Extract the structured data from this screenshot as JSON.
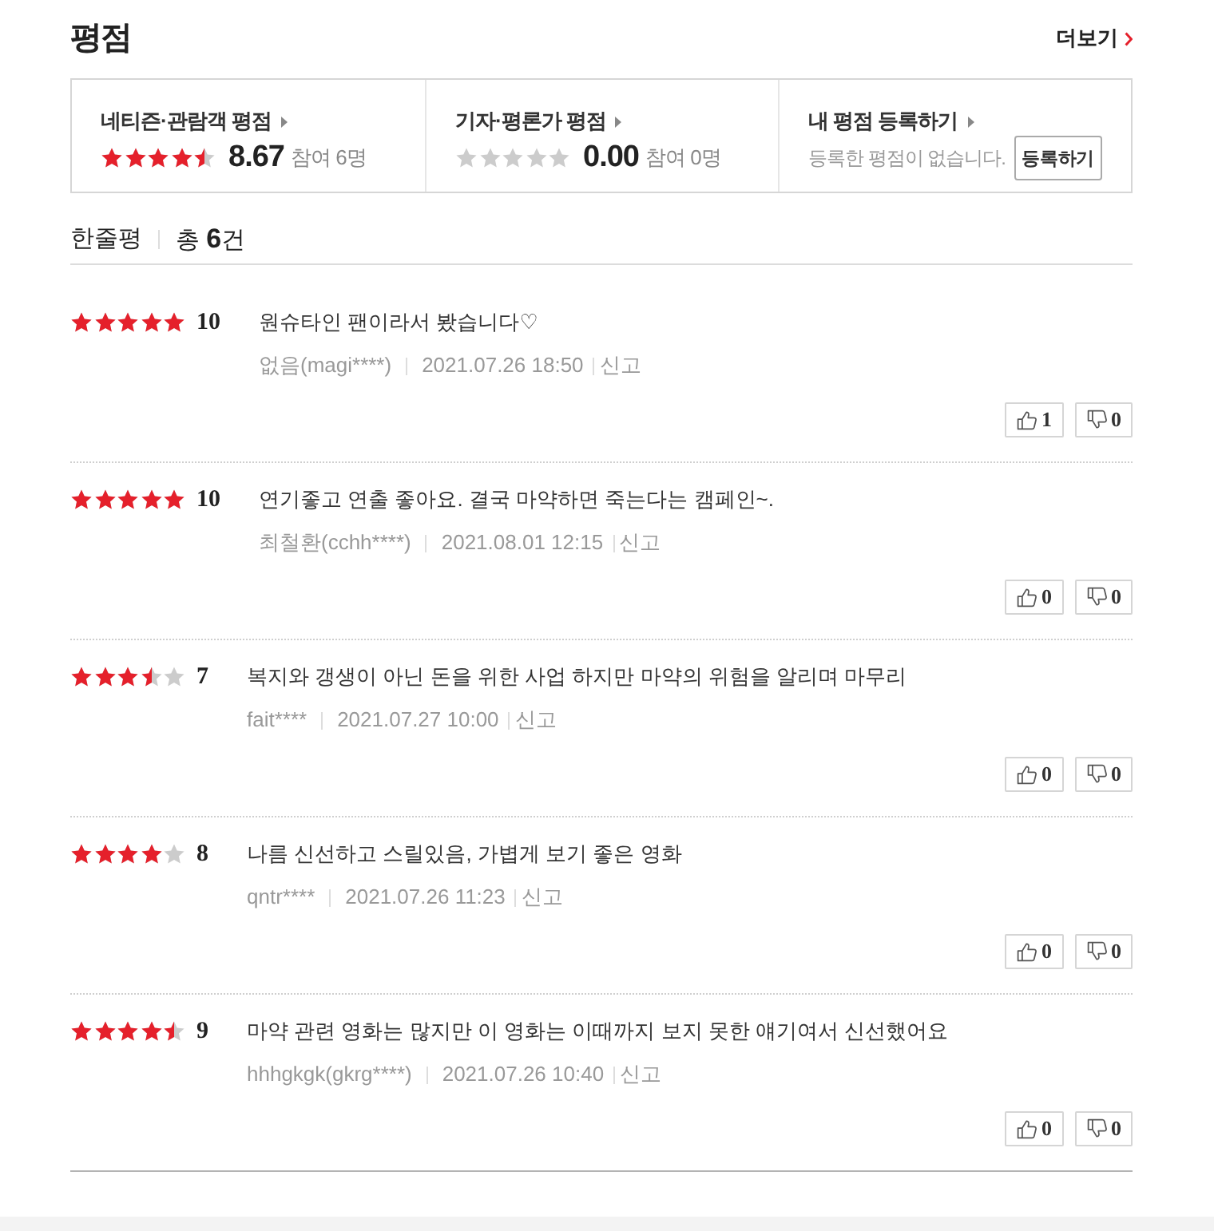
{
  "header": {
    "title": "평점",
    "more_link": "더보기"
  },
  "summary": [
    {
      "kind": "score",
      "label": "네티즌·관람객 평점",
      "stars": 4.5,
      "score": "8.67",
      "participants": "참여 6명"
    },
    {
      "kind": "score",
      "label": "기자·평론가 평점",
      "stars": 0,
      "score": "0.00",
      "participants": "참여 0명"
    },
    {
      "kind": "register",
      "label": "내 평점 등록하기",
      "message": "등록한 평점이 없습니다.",
      "button": "등록하기"
    }
  ],
  "reviews_header": {
    "title": "한줄평",
    "count": "총 **6**건"
  },
  "reviews": [
    {
      "stars": 5,
      "score": "10",
      "text": "원슈타인 팬이라서 봤습니다♡",
      "author": "없음(magi****)",
      "date": "2021.07.26 18:50",
      "report": "신고",
      "likes": "1",
      "dislikes": "0"
    },
    {
      "stars": 5,
      "score": "10",
      "text": "연기좋고 연출 좋아요. 결국 마약하면 죽는다는 캠페인~.",
      "author": "최철환(cchh****)",
      "date": "2021.08.01 12:15",
      "report": "신고",
      "likes": "0",
      "dislikes": "0"
    },
    {
      "stars": 3.5,
      "score": "7",
      "text": "복지와 갱생이 아닌 돈을 위한 사업 하지만 마약의 위험을 알리며 마무리",
      "author": "fait****",
      "date": "2021.07.27 10:00",
      "report": "신고",
      "likes": "0",
      "dislikes": "0"
    },
    {
      "stars": 4,
      "score": "8",
      "text": "나름 신선하고 스릴있음, 가볍게 보기 좋은 영화",
      "author": "qntr****",
      "date": "2021.07.26 11:23",
      "report": "신고",
      "likes": "0",
      "dislikes": "0"
    },
    {
      "stars": 4.5,
      "score": "9",
      "text": "마약 관련 영화는 많지만 이 영화는 이때까지 보지 못한 얘기여서 신선했어요",
      "author": "hhhgkgk(gkrg****)",
      "date": "2021.07.26 10:40",
      "report": "신고",
      "likes": "0",
      "dislikes": "0"
    }
  ]
}
